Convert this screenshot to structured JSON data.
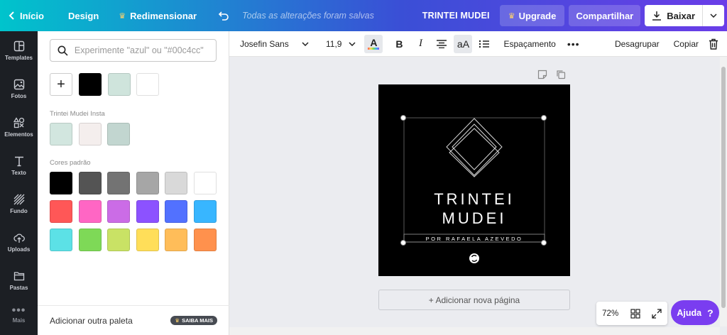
{
  "topbar": {
    "home": "Início",
    "design": "Design",
    "resize": "Redimensionar",
    "saved_status": "Todas as alterações foram salvas",
    "project_title": "TRINTEI MUDEI",
    "upgrade": "Upgrade",
    "share": "Compartilhar",
    "download": "Baixar"
  },
  "rail": {
    "items": [
      "Templates",
      "Fotos",
      "Elementos",
      "Texto",
      "Fundo",
      "Uploads",
      "Pastas",
      "Mais"
    ]
  },
  "panel": {
    "search_placeholder": "Experimente \"azul\" ou \"#00c4cc\"",
    "doc_colors": [
      "#000000",
      "#cfe4dc",
      "#ffffff"
    ],
    "brand_section": "Trintei Mudei Insta",
    "brand_colors": [
      "#d2e6df",
      "#f4eeed",
      "#c2d6d0"
    ],
    "default_section": "Cores padrão",
    "default_colors": [
      "#000000",
      "#545454",
      "#737373",
      "#a6a6a6",
      "#d9d9d9",
      "#ffffff",
      "#ff5757",
      "#ff66c4",
      "#cb6ce6",
      "#8c52ff",
      "#5271ff",
      "#38b6ff",
      "#5ce1e6",
      "#7ed957",
      "#c9e265",
      "#ffde59",
      "#ffbd59",
      "#ff914d"
    ],
    "footer_text": "Adicionar outra paleta",
    "footer_badge": "SAIBA MAIS"
  },
  "toolbar": {
    "font": "Josefin Sans",
    "size": "11,9",
    "spacing": "Espaçamento",
    "ungroup": "Desagrupar",
    "copy": "Copiar"
  },
  "canvas": {
    "title_line1": "TRINTEI",
    "title_line2": "MUDEI",
    "subtitle": "POR RAFAELA AZEVEDO",
    "add_page": "+ Adicionar nova página",
    "zoom": "72%",
    "help": "Ajuda"
  }
}
